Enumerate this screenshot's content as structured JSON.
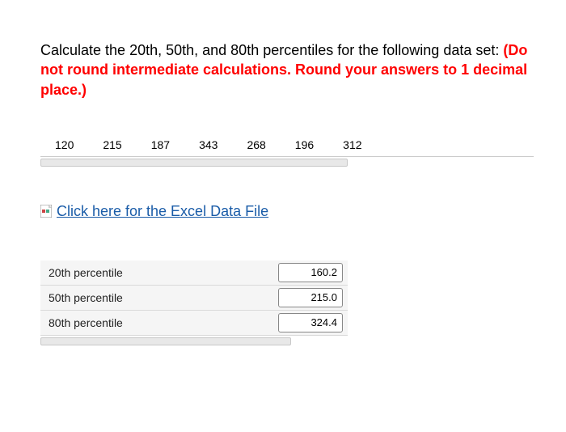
{
  "question": {
    "part1": "Calculate the 20th, 50th, and 80th percentiles for the following data set: ",
    "part2": "(Do not round intermediate calculations. Round your answers to 1 decimal place.)"
  },
  "data_values": [
    "120",
    "215",
    "187",
    "343",
    "268",
    "196",
    "312"
  ],
  "link": {
    "label": "Click here for the Excel Data File"
  },
  "answers": [
    {
      "label": "20th percentile",
      "value": "160.2"
    },
    {
      "label": "50th percentile",
      "value": "215.0"
    },
    {
      "label": "80th percentile",
      "value": "324.4"
    }
  ]
}
